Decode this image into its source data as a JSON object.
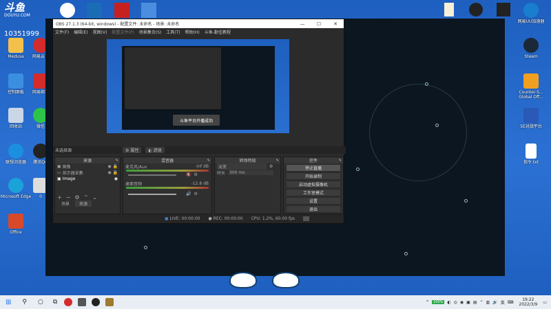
{
  "desktop_icons": [
    {
      "label": "Medusa",
      "color": "#f3c14b"
    },
    {
      "label": "网易云音",
      "color": "#d42b2b"
    },
    {
      "label": "控制面板",
      "color": "#3b8fe0"
    },
    {
      "label": "网易邮箱",
      "color": "#d42b2b"
    },
    {
      "label": "回收站",
      "color": "#c9d7e6"
    },
    {
      "label": "微信",
      "color": "#2ec44a"
    },
    {
      "label": "联想浏览器",
      "color": "#1c8fe0"
    },
    {
      "label": "腾讯QQ",
      "color": "#222222"
    },
    {
      "label": "Microsoft Edge",
      "color": "#1ba2d8"
    },
    {
      "label": "0",
      "color": "#dddddd"
    },
    {
      "label": "Office",
      "color": "#d8492a"
    }
  ],
  "right_icons": [
    {
      "label": "网易UU加速器",
      "color": "#1a7ecf"
    },
    {
      "label": "Steam",
      "color": "#1b2838"
    },
    {
      "label": "Counter-S... Global Off...",
      "color": "#f0a020"
    },
    {
      "label": "5E对战平台",
      "color": "#2a59b8"
    },
    {
      "label": "指令.txt",
      "color": "#ffffff"
    }
  ],
  "logo": {
    "name": "斗鱼",
    "domain": "DOUYU.COM",
    "id": "10351999"
  },
  "obs": {
    "title": "OBS 27.1.3 (64-bit, windows) - 配置文件: 未命名 - 场景: 未命名",
    "menu": [
      "文件(F)",
      "编辑(E)",
      "视图(V)",
      "配置文件(P)",
      "场景集合(S)",
      "工具(T)",
      "帮助(H)",
      "斗鱼-勤佳教程"
    ],
    "toast": "斗鱼平台开播成功",
    "scene_bar": {
      "label": "未选择源",
      "props": "属性",
      "filters": "滤镜"
    },
    "docks": {
      "sources": "来源",
      "mixer": "混音器",
      "transitions": "转场特效",
      "controls": "控件"
    },
    "sources": [
      "图像",
      "显示器采集",
      "Image"
    ],
    "scene_tabs": {
      "scenes": "场景",
      "sources": "来源"
    },
    "mixer": {
      "ch1": {
        "name": "麦克风/Aux",
        "db": "-inf dB"
      },
      "ch2": {
        "name": "桌面音频",
        "db": "-12.8 dB"
      }
    },
    "transitions": {
      "type": "淡变",
      "duration_label": "时长",
      "duration": "300 ms"
    },
    "controls": [
      "停止直播",
      "开始录制",
      "启动虚拟摄像机",
      "工作室模式",
      "设置",
      "退出"
    ],
    "status": {
      "live": "LIVE: 00:00:00",
      "rec": "REC: 00:00:00",
      "cpu": "CPU: 1.2%, 60.00 fps"
    }
  },
  "taskbar": {
    "time": "19:22",
    "date": "2022/3/9",
    "ime": "英",
    "battery": "100%"
  }
}
